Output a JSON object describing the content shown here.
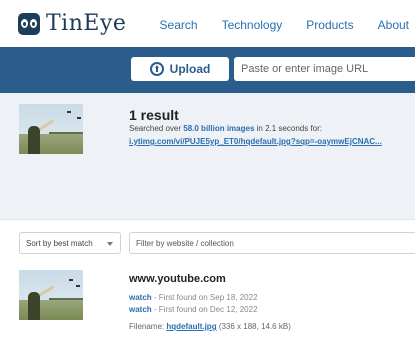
{
  "header": {
    "logo_text": "TinEye",
    "nav": [
      "Search",
      "Technology",
      "Products",
      "About"
    ]
  },
  "search": {
    "upload_label": "Upload",
    "url_placeholder": "Paste or enter image URL"
  },
  "summary": {
    "result_count": "1 result",
    "searched_prefix": "Searched over",
    "index_size": "58.0 billion images",
    "searched_suffix": "in 2.1 seconds for:",
    "query_url": "i.ytimg.com/vi/PUJE5yp_ET0/hqdefault.jpg?sqp=-oaymwEjCNAC..."
  },
  "filters": {
    "sort_label": "Sort by best match",
    "filter_placeholder": "Filter by website / collection"
  },
  "match": {
    "domain": "www.youtube.com",
    "entries": [
      {
        "link": "watch",
        "found": "- First found on Sep 18, 2022"
      },
      {
        "link": "watch",
        "found": "- First found on Dec 12, 2022"
      }
    ],
    "filename_label": "Filename:",
    "filename": "hqdefault.jpg",
    "file_info": "(336 x 188, 14.6 kB)"
  }
}
